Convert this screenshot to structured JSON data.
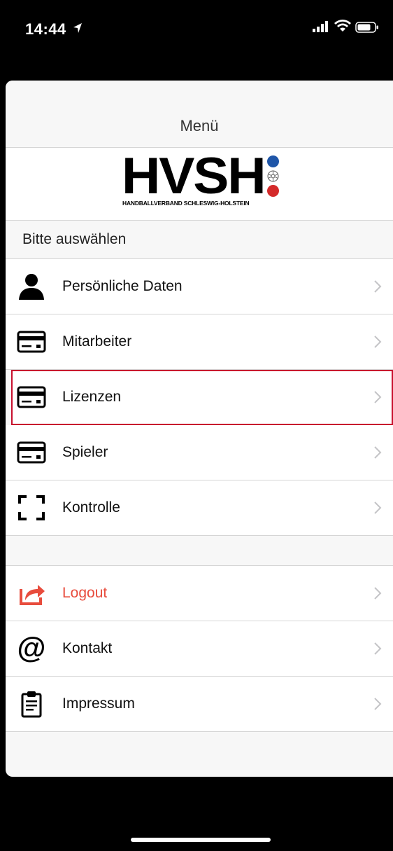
{
  "status": {
    "time": "14:44"
  },
  "nav": {
    "title": "Menü"
  },
  "logo": {
    "text": "HVSH",
    "subtitle": "HANDBALLVERBAND SCHLESWIG-HOLSTEIN"
  },
  "section": {
    "header": "Bitte auswählen"
  },
  "menu": [
    {
      "label": "Persönliche Daten",
      "icon": "person-icon"
    },
    {
      "label": "Mitarbeiter",
      "icon": "card-icon"
    },
    {
      "label": "Lizenzen",
      "icon": "card-icon"
    },
    {
      "label": "Spieler",
      "icon": "card-icon"
    },
    {
      "label": "Kontrolle",
      "icon": "scan-frame-icon"
    }
  ],
  "menu2": [
    {
      "label": "Logout",
      "icon": "share-out-icon"
    },
    {
      "label": "Kontakt",
      "icon": "at-icon"
    },
    {
      "label": "Impressum",
      "icon": "clipboard-icon"
    }
  ],
  "colors": {
    "logout": "#e84c3d",
    "highlight": "#c8102e",
    "ball_blue": "#1f56a8",
    "ball_red": "#d42a2a"
  }
}
